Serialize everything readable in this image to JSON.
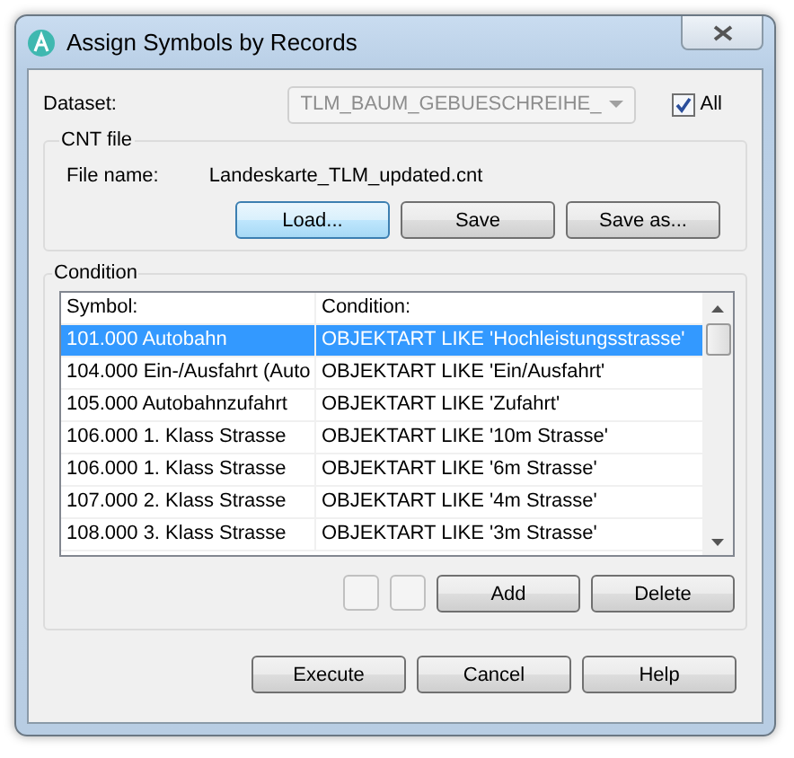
{
  "window": {
    "title": "Assign Symbols by Records"
  },
  "dataset": {
    "label": "Dataset:",
    "value": "TLM_BAUM_GEBUESCHREIHE_",
    "disabled": true,
    "all_label": "All",
    "all_checked": true
  },
  "cnt_file": {
    "title": "CNT file",
    "file_label": "File name:",
    "file_name": "Landeskarte_TLM_updated.cnt",
    "buttons": [
      {
        "label": "Load...",
        "focused": true
      },
      {
        "label": "Save",
        "focused": false
      },
      {
        "label": "Save as...",
        "focused": false
      }
    ]
  },
  "condition": {
    "title": "Condition",
    "columns": [
      "Symbol:",
      "Condition:"
    ],
    "rows": [
      {
        "symbol": "101.000 Autobahn",
        "condition": "OBJEKTART LIKE 'Hochleistungsstrasse'",
        "selected": true
      },
      {
        "symbol": "104.000 Ein-/Ausfahrt (Auto",
        "condition": "OBJEKTART LIKE 'Ein/Ausfahrt'",
        "selected": false
      },
      {
        "symbol": "105.000 Autobahnzufahrt",
        "condition": "OBJEKTART LIKE 'Zufahrt'",
        "selected": false
      },
      {
        "symbol": "106.000 1. Klass Strasse",
        "condition": "OBJEKTART LIKE '10m Strasse'",
        "selected": false
      },
      {
        "symbol": "106.000 1. Klass Strasse",
        "condition": "OBJEKTART LIKE '6m Strasse'",
        "selected": false
      },
      {
        "symbol": "107.000 2. Klass Strasse",
        "condition": "OBJEKTART LIKE '4m Strasse'",
        "selected": false
      },
      {
        "symbol": "108.000 3. Klass Strasse",
        "condition": "OBJEKTART LIKE '3m Strasse'",
        "selected": false
      }
    ],
    "small_buttons": [
      {
        "disabled": true
      },
      {
        "disabled": true
      }
    ],
    "buttons": [
      {
        "label": "Add",
        "focused": false
      },
      {
        "label": "Delete",
        "focused": false
      }
    ]
  },
  "buttons": [
    {
      "label": "Execute",
      "focused": false
    },
    {
      "label": "Cancel",
      "focused": false
    },
    {
      "label": "Help",
      "focused": false
    }
  ]
}
